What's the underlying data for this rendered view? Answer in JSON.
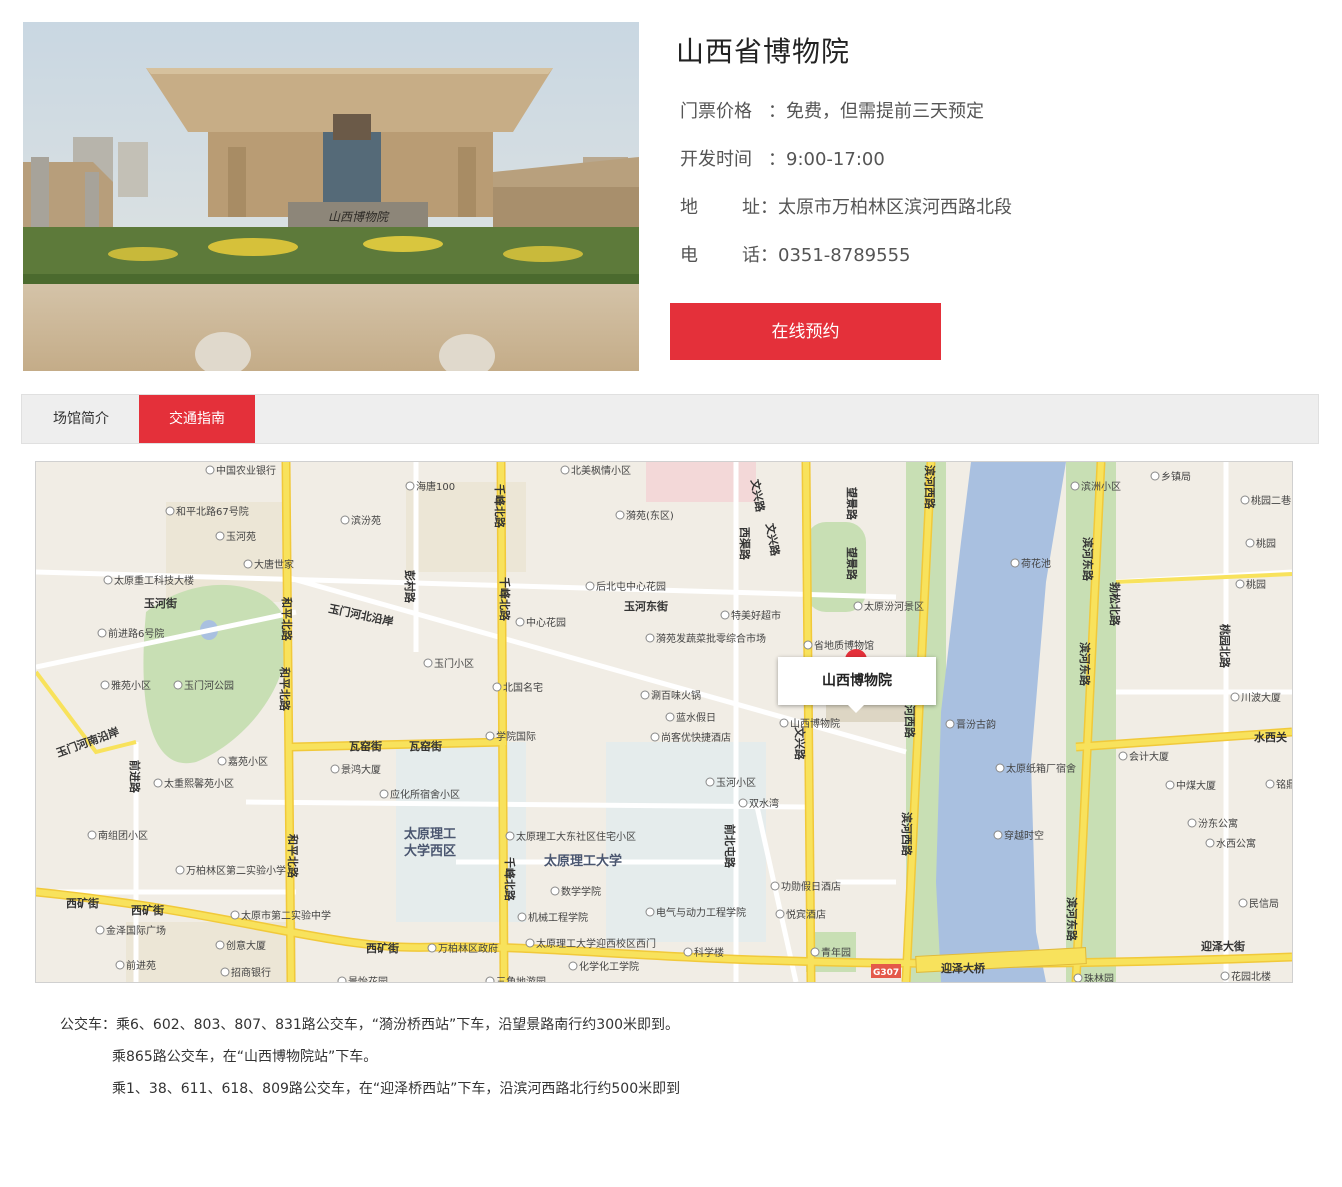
{
  "museum": {
    "name": "山西省博物院",
    "ticket_label": "门票价格",
    "ticket_value": "免费，但需提前三天预定",
    "hours_label": "开发时间",
    "hours_value": "9:00-17:00",
    "address_label_1": "地",
    "address_label_2": "址",
    "address_value": "太原市万柏林区滨河西路北段",
    "phone_label_1": "电",
    "phone_label_2": "话",
    "phone_value": "0351-8789555",
    "colon": "：",
    "book_button": "在线预约",
    "photo_sign": "山西博物院"
  },
  "tabs": [
    {
      "label": "场馆简介",
      "active": false
    },
    {
      "label": "交通指南",
      "active": true
    }
  ],
  "map": {
    "popup_title": "山西博物院",
    "districts": {
      "d1": "太原理工大学西区",
      "d1a": "太原理工",
      "d1b": "大学西区",
      "d2": "太原理工大学"
    },
    "roads": {
      "wenxing": "文兴路",
      "wenxing2": "文兴路",
      "wenxing3": "文兴路",
      "wangjing": "望景路",
      "wangjing2": "望景路",
      "qianfeng": "千峰北路",
      "qianfeng2": "千峰北路",
      "qianfeng3": "千峰北路",
      "heping": "和平北路",
      "heping2": "和平北路",
      "heping3": "和平北路",
      "binhexi": "滨河西路",
      "binhexi2": "滨河西路",
      "binhexi3": "滨河西路",
      "binhedong": "滨河东路",
      "binhedong2": "滨河东路",
      "binhedong3": "滨河东路",
      "xiqu": "西渠路",
      "pengcun": "彭村路",
      "yumenhe": "玉门河北沿岸",
      "yumenhe_s": "玉门河南沿岸",
      "yuhe": "玉河街",
      "yuhedong": "玉河东街",
      "wayao": "瓦窑街",
      "wayao2": "瓦窑街",
      "xikuang": "西矿街",
      "xikuang2": "西矿街",
      "xikuang3": "西矿街",
      "yingze": "迎泽大街",
      "yingze_bridge": "迎泽大桥",
      "qianbeitun": "前北屯路",
      "qianjin": "前进路",
      "shuixi": "水西关",
      "taoyuan": "桃园北路",
      "shengsong": "勃松北路",
      "g307": "G307"
    },
    "pois": [
      "中国农业银行",
      "海唐100",
      "北美枫情小区",
      "滨洲小区",
      "乡镇局",
      "桃园二巷",
      "和平北路67号院",
      "滨汾苑",
      "漪苑(东区)",
      "桃园",
      "玉河苑",
      "大唐世家",
      "荷花池",
      "太原重工科技大楼",
      "后北屯中心花园",
      "桃园",
      "太原汾河景区",
      "前进路6号院",
      "中心花园",
      "特美好超市",
      "玉门小区",
      "漪苑发蔬菜批零综合市场",
      "省地质博物馆",
      "雅苑小区",
      "玉门河公园",
      "北国名宅",
      "涮百味火锅",
      "川波大厦",
      "蓝水假日",
      "山西博物院",
      "晋汾古韵",
      "学院国际",
      "尚客优快捷酒店",
      "嘉苑小区",
      "景鸿大厦",
      "会计大厦",
      "太原纸箱厂宿舍",
      "太重熙馨苑小区",
      "玉河小区",
      "中煤大厦",
      "铭鼎",
      "应化所宿舍小区",
      "双水湾",
      "汾东公寓",
      "南组团小区",
      "太原理工大东社区住宅小区",
      "穿越时空",
      "水西公寓",
      "万柏林区第二实验小学",
      "功勋假日酒店",
      "数学学院",
      "民信局",
      "电气与动力工程学院",
      "机械工程学院",
      "悦宾酒店",
      "太原市第二实验中学",
      "金泽国际广场",
      "创意大厦",
      "万柏林区政府",
      "太原理工大学迎西校区西门",
      "科学楼",
      "青年园",
      "前进苑",
      "招商银行",
      "化学化工学院",
      "花园北楼",
      "珠林园",
      "景怡花园",
      "三角地游园"
    ]
  },
  "bus": {
    "line1": "公交车：乘6、602、803、807、831路公交车，“漪汾桥西站”下车，沿望景路南行约300米即到。",
    "line2": "乘865路公交车，在“山西博物院站”下车。",
    "line3": "乘1、38、611、618、809路公交车，在“迎泽桥西站”下车，沿滨河西路北行约500米即到"
  },
  "colors": {
    "accent": "#e4303a",
    "river": "#a9c0e0",
    "major_road": "#f8e25c",
    "park": "#c8dfb4"
  }
}
